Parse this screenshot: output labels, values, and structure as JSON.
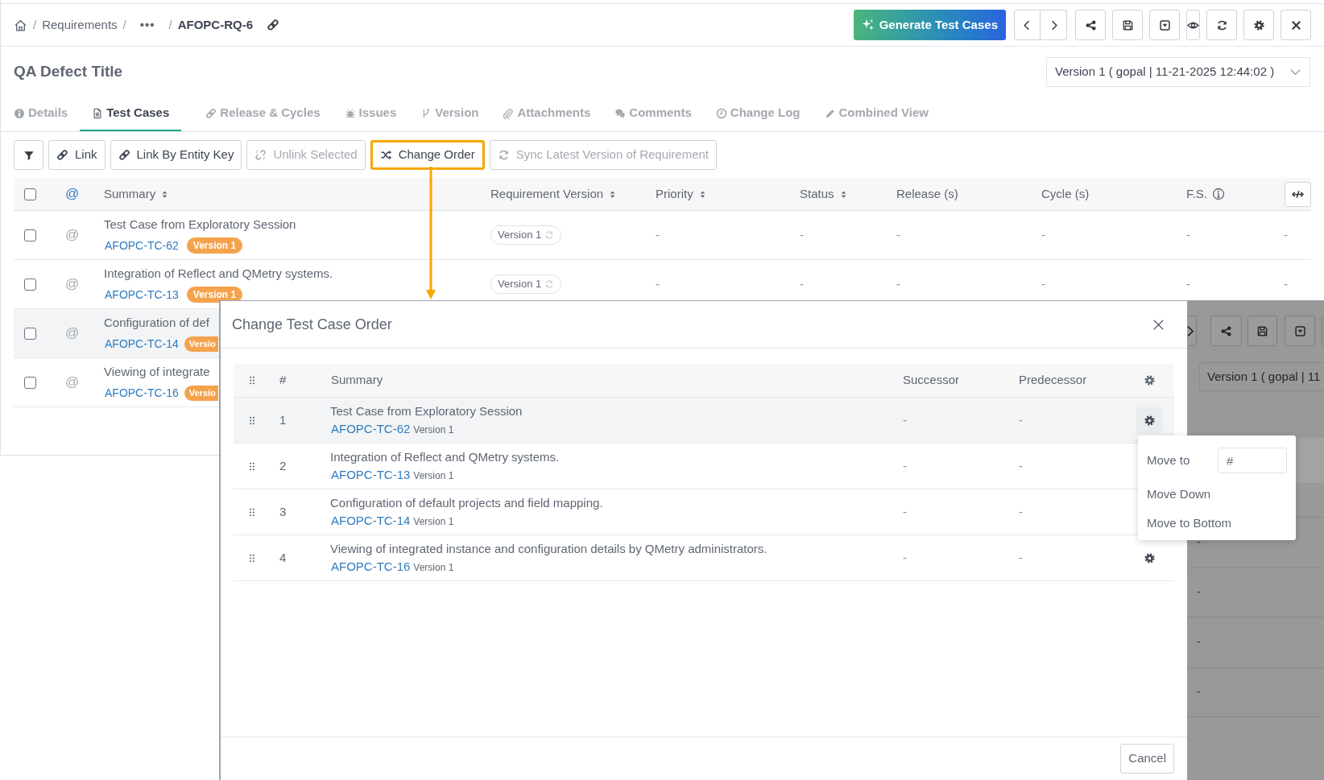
{
  "breadcrumb": [
    {
      "separator": "/",
      "label": "Requirements",
      "kind": "link"
    },
    {
      "separator": "/",
      "label": "•••",
      "kind": "link"
    },
    {
      "separator": "/",
      "label": "AFOPC-RQ-6",
      "kind": "current"
    }
  ],
  "generate_button": "Generate Test Cases",
  "title": "QA Defect Title",
  "version_select": {
    "value": "Version 1 ( gopal | 11-21-2025 12:44:02 )"
  },
  "tabs": [
    {
      "label": "Details",
      "selected": false
    },
    {
      "label": "Test Cases",
      "selected": true
    },
    {
      "label": "Release & Cycles",
      "selected": false
    },
    {
      "label": "Issues",
      "selected": false
    },
    {
      "label": "Version",
      "selected": false
    },
    {
      "label": "Attachments",
      "selected": false
    },
    {
      "label": "Comments",
      "selected": false
    },
    {
      "label": "Change Log",
      "selected": false
    },
    {
      "label": "Combined View",
      "selected": false
    }
  ],
  "toolbar": [
    {
      "label": "Link",
      "disabled": false,
      "highlighted": false
    },
    {
      "label": "Link By Entity Key",
      "disabled": false,
      "highlighted": false
    },
    {
      "label": "Unlink Selected",
      "disabled": true,
      "highlighted": false
    },
    {
      "label": "Change Order",
      "disabled": false,
      "highlighted": true
    },
    {
      "label": "Sync Latest Version of Requirement",
      "disabled": true,
      "highlighted": false
    }
  ],
  "table": {
    "select_all": {
      "checked": false
    },
    "columns": [
      {
        "label": "@",
        "sortable": false
      },
      {
        "label": "Summary",
        "sortable": true
      },
      {
        "label": "Requirement Version",
        "sortable": true
      },
      {
        "label": "Priority",
        "sortable": true
      },
      {
        "label": "Status",
        "sortable": true
      },
      {
        "label": "Release (s)",
        "sortable": false
      },
      {
        "label": "Cycle (s)",
        "sortable": false
      },
      {
        "label": "F.S.",
        "sortable": false
      }
    ],
    "rows": [
      {
        "checked": false,
        "highlighted": false,
        "mention": "@",
        "summary": "Test Case from Exploratory Session",
        "key": "AFOPC-TC-62",
        "badge": "Version 1",
        "cells": [
          "Version  1",
          "-",
          "-",
          "-",
          "-",
          "-",
          "-"
        ]
      },
      {
        "checked": false,
        "highlighted": false,
        "mention": "@",
        "summary": "Integration of Reflect and QMetry systems.",
        "key": "AFOPC-TC-13",
        "badge": "Version 1",
        "cells": [
          "Version  1",
          "-",
          "-",
          "-",
          "-",
          "-",
          "-"
        ]
      },
      {
        "checked": false,
        "highlighted": true,
        "mention": "@",
        "summary": "Configuration of def",
        "key": "AFOPC-TC-14",
        "badge": "Versio"
      },
      {
        "checked": false,
        "highlighted": false,
        "mention": "@",
        "summary": "Viewing of integrate",
        "key": "AFOPC-TC-16",
        "badge": "Versio"
      }
    ]
  },
  "modal": {
    "title": "Change Test Case Order",
    "columns": [
      "#",
      "Summary",
      "Successor",
      "Predecessor"
    ],
    "rows": [
      {
        "number": "1",
        "summary": "Test Case from Exploratory Session",
        "key": "AFOPC-TC-62",
        "version": "Version 1",
        "successor": "-",
        "predecessor": "-",
        "selected": true
      },
      {
        "number": "2",
        "summary": "Integration of Reflect and QMetry systems.",
        "key": "AFOPC-TC-13",
        "version": "Version 1",
        "successor": "-",
        "predecessor": "-",
        "selected": false
      },
      {
        "number": "3",
        "summary": "Configuration of default projects and field mapping.",
        "key": "AFOPC-TC-14",
        "version": "Version 1",
        "successor": "-",
        "predecessor": "-",
        "selected": false
      },
      {
        "number": "4",
        "summary": "Viewing of integrated instance and configuration details by QMetry administrators.",
        "key": "AFOPC-TC-16",
        "version": "Version 1",
        "successor": "-",
        "predecessor": "-",
        "selected": false
      }
    ],
    "menu": {
      "move_to_label": "Move to",
      "placeholder": "#",
      "items": [
        "Move Down",
        "Move to Bottom"
      ]
    },
    "cancel_button": "Cancel"
  },
  "background_page": {
    "version_select": "Version 1 ( gopal | 11",
    "cells": [
      "-",
      "-",
      "-",
      "-"
    ]
  }
}
